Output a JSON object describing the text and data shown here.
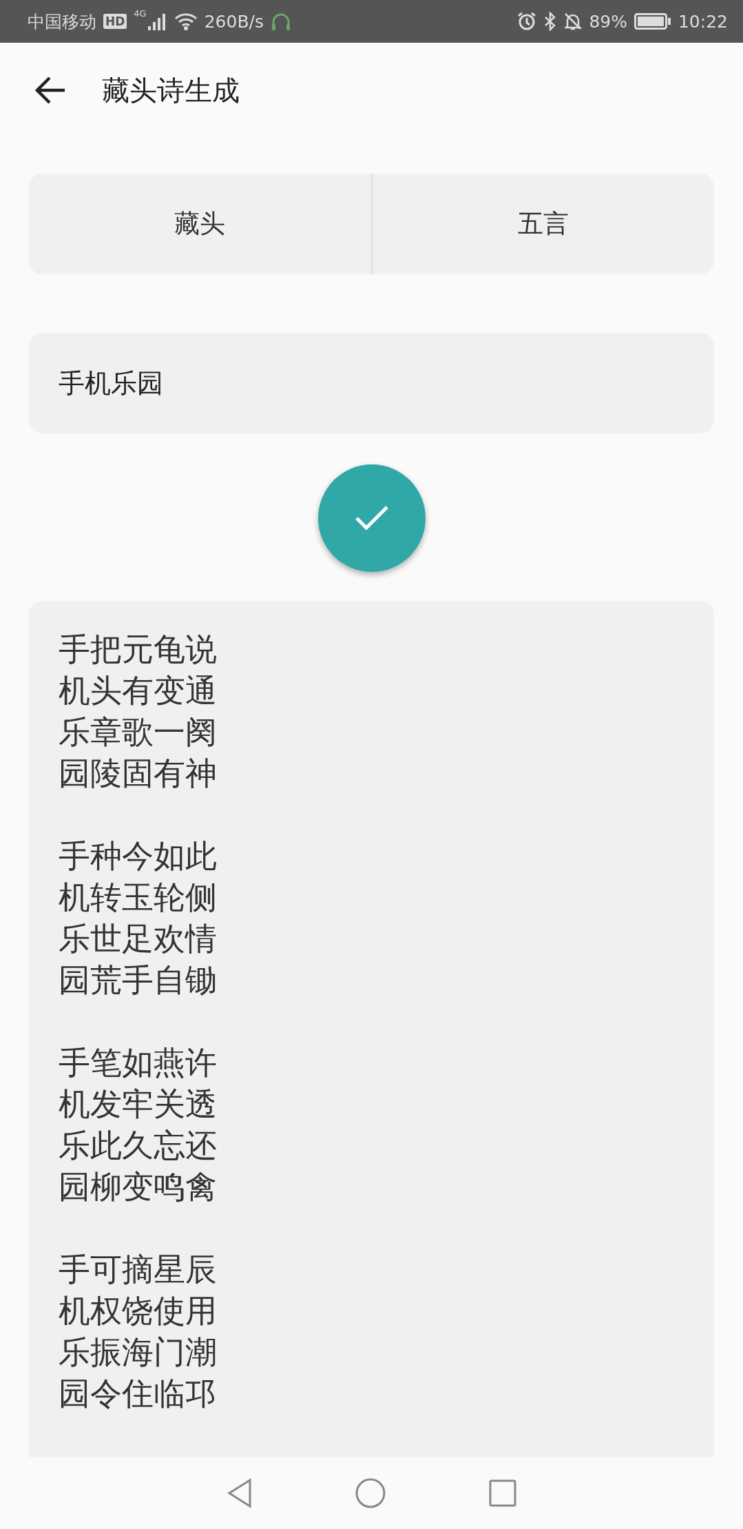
{
  "status_bar": {
    "carrier": "中国移动",
    "hd": "HD",
    "network": "4G",
    "speed": "260B/s",
    "battery_percent": "89%",
    "time": "10:22"
  },
  "app_bar": {
    "title": "藏头诗生成"
  },
  "options": [
    {
      "label": "藏头"
    },
    {
      "label": "五言"
    }
  ],
  "input": {
    "value": "手机乐园"
  },
  "poem": {
    "stanzas": [
      [
        "手把元龟说",
        "机头有变通",
        "乐章歌一阕",
        "园陵固有神"
      ],
      [
        "手种今如此",
        "机转玉轮侧",
        "乐世足欢情",
        "园荒手自锄"
      ],
      [
        "手笔如燕许",
        "机发牢关透",
        "乐此久忘还",
        "园柳变鸣禽"
      ],
      [
        "手可摘星辰",
        "机权饶使用",
        "乐振海门潮",
        "园令住临邛"
      ]
    ]
  }
}
